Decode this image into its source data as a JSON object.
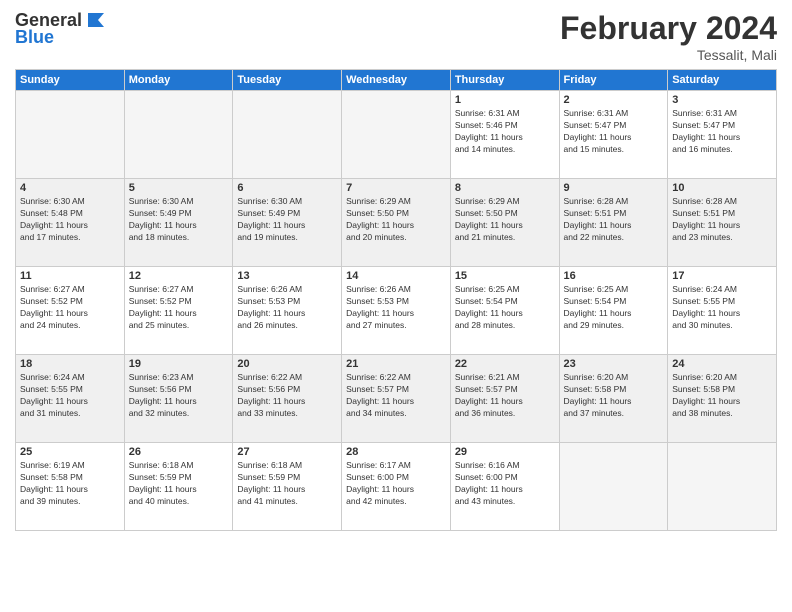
{
  "header": {
    "logo_general": "General",
    "logo_blue": "Blue",
    "month_title": "February 2024",
    "location": "Tessalit, Mali"
  },
  "days_of_week": [
    "Sunday",
    "Monday",
    "Tuesday",
    "Wednesday",
    "Thursday",
    "Friday",
    "Saturday"
  ],
  "weeks": [
    [
      {
        "day": "",
        "info": ""
      },
      {
        "day": "",
        "info": ""
      },
      {
        "day": "",
        "info": ""
      },
      {
        "day": "",
        "info": ""
      },
      {
        "day": "1",
        "info": "Sunrise: 6:31 AM\nSunset: 5:46 PM\nDaylight: 11 hours\nand 14 minutes."
      },
      {
        "day": "2",
        "info": "Sunrise: 6:31 AM\nSunset: 5:47 PM\nDaylight: 11 hours\nand 15 minutes."
      },
      {
        "day": "3",
        "info": "Sunrise: 6:31 AM\nSunset: 5:47 PM\nDaylight: 11 hours\nand 16 minutes."
      }
    ],
    [
      {
        "day": "4",
        "info": "Sunrise: 6:30 AM\nSunset: 5:48 PM\nDaylight: 11 hours\nand 17 minutes."
      },
      {
        "day": "5",
        "info": "Sunrise: 6:30 AM\nSunset: 5:49 PM\nDaylight: 11 hours\nand 18 minutes."
      },
      {
        "day": "6",
        "info": "Sunrise: 6:30 AM\nSunset: 5:49 PM\nDaylight: 11 hours\nand 19 minutes."
      },
      {
        "day": "7",
        "info": "Sunrise: 6:29 AM\nSunset: 5:50 PM\nDaylight: 11 hours\nand 20 minutes."
      },
      {
        "day": "8",
        "info": "Sunrise: 6:29 AM\nSunset: 5:50 PM\nDaylight: 11 hours\nand 21 minutes."
      },
      {
        "day": "9",
        "info": "Sunrise: 6:28 AM\nSunset: 5:51 PM\nDaylight: 11 hours\nand 22 minutes."
      },
      {
        "day": "10",
        "info": "Sunrise: 6:28 AM\nSunset: 5:51 PM\nDaylight: 11 hours\nand 23 minutes."
      }
    ],
    [
      {
        "day": "11",
        "info": "Sunrise: 6:27 AM\nSunset: 5:52 PM\nDaylight: 11 hours\nand 24 minutes."
      },
      {
        "day": "12",
        "info": "Sunrise: 6:27 AM\nSunset: 5:52 PM\nDaylight: 11 hours\nand 25 minutes."
      },
      {
        "day": "13",
        "info": "Sunrise: 6:26 AM\nSunset: 5:53 PM\nDaylight: 11 hours\nand 26 minutes."
      },
      {
        "day": "14",
        "info": "Sunrise: 6:26 AM\nSunset: 5:53 PM\nDaylight: 11 hours\nand 27 minutes."
      },
      {
        "day": "15",
        "info": "Sunrise: 6:25 AM\nSunset: 5:54 PM\nDaylight: 11 hours\nand 28 minutes."
      },
      {
        "day": "16",
        "info": "Sunrise: 6:25 AM\nSunset: 5:54 PM\nDaylight: 11 hours\nand 29 minutes."
      },
      {
        "day": "17",
        "info": "Sunrise: 6:24 AM\nSunset: 5:55 PM\nDaylight: 11 hours\nand 30 minutes."
      }
    ],
    [
      {
        "day": "18",
        "info": "Sunrise: 6:24 AM\nSunset: 5:55 PM\nDaylight: 11 hours\nand 31 minutes."
      },
      {
        "day": "19",
        "info": "Sunrise: 6:23 AM\nSunset: 5:56 PM\nDaylight: 11 hours\nand 32 minutes."
      },
      {
        "day": "20",
        "info": "Sunrise: 6:22 AM\nSunset: 5:56 PM\nDaylight: 11 hours\nand 33 minutes."
      },
      {
        "day": "21",
        "info": "Sunrise: 6:22 AM\nSunset: 5:57 PM\nDaylight: 11 hours\nand 34 minutes."
      },
      {
        "day": "22",
        "info": "Sunrise: 6:21 AM\nSunset: 5:57 PM\nDaylight: 11 hours\nand 36 minutes."
      },
      {
        "day": "23",
        "info": "Sunrise: 6:20 AM\nSunset: 5:58 PM\nDaylight: 11 hours\nand 37 minutes."
      },
      {
        "day": "24",
        "info": "Sunrise: 6:20 AM\nSunset: 5:58 PM\nDaylight: 11 hours\nand 38 minutes."
      }
    ],
    [
      {
        "day": "25",
        "info": "Sunrise: 6:19 AM\nSunset: 5:58 PM\nDaylight: 11 hours\nand 39 minutes."
      },
      {
        "day": "26",
        "info": "Sunrise: 6:18 AM\nSunset: 5:59 PM\nDaylight: 11 hours\nand 40 minutes."
      },
      {
        "day": "27",
        "info": "Sunrise: 6:18 AM\nSunset: 5:59 PM\nDaylight: 11 hours\nand 41 minutes."
      },
      {
        "day": "28",
        "info": "Sunrise: 6:17 AM\nSunset: 6:00 PM\nDaylight: 11 hours\nand 42 minutes."
      },
      {
        "day": "29",
        "info": "Sunrise: 6:16 AM\nSunset: 6:00 PM\nDaylight: 11 hours\nand 43 minutes."
      },
      {
        "day": "",
        "info": ""
      },
      {
        "day": "",
        "info": ""
      }
    ]
  ]
}
